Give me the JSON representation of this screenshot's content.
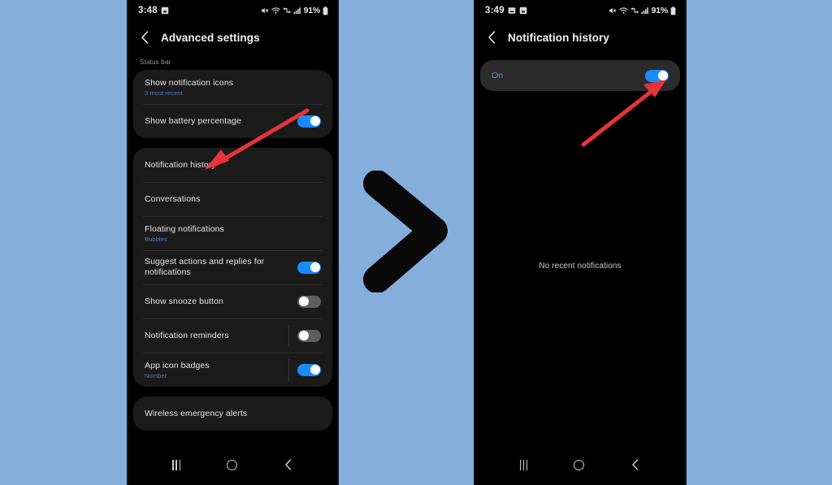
{
  "meta": {
    "background_color": "#86aedc",
    "accent_blue": "#1a8cff",
    "link_blue": "#4e7fd0",
    "arrow_red": "#e8333a",
    "card_color": "#1b1b1b",
    "card_highlight_color": "#2b2b2b"
  },
  "left_phone": {
    "status_bar": {
      "time": "3:48",
      "battery": "91%",
      "icons": [
        "mute-icon",
        "wifi-icon",
        "vpn-icon",
        "signal-icon",
        "battery-icon"
      ]
    },
    "app_bar": {
      "back_icon": "back-chevron-icon",
      "title": "Advanced settings"
    },
    "section_label": "Status bar",
    "cards": [
      {
        "rows": [
          {
            "title": "Show notification icons",
            "subtitle": "3 most recent",
            "toggle": null
          },
          {
            "title": "Show battery percentage",
            "subtitle": "",
            "toggle": "on"
          }
        ]
      },
      {
        "rows": [
          {
            "title": "Notification history",
            "subtitle": "",
            "toggle": null
          },
          {
            "title": "Conversations",
            "subtitle": "",
            "toggle": null
          },
          {
            "title": "Floating notifications",
            "subtitle": "Bubbles",
            "toggle": null
          },
          {
            "title": "Suggest actions and replies for notifications",
            "subtitle": "",
            "toggle": "on"
          },
          {
            "title": "Show snooze button",
            "subtitle": "",
            "toggle": "off"
          },
          {
            "title": "Notification reminders",
            "subtitle": "",
            "toggle": "off"
          },
          {
            "title": "App icon badges",
            "subtitle": "Number",
            "toggle": "on"
          }
        ]
      },
      {
        "rows": [
          {
            "title": "Wireless emergency alerts",
            "subtitle": "",
            "toggle": null
          }
        ]
      }
    ],
    "nav_bar": {
      "recents": "recents-icon",
      "home": "home-icon",
      "back": "back-icon"
    }
  },
  "right_phone": {
    "status_bar": {
      "time": "3:49",
      "battery": "91%",
      "icons": [
        "screenshot-icon",
        "mute-icon",
        "wifi-icon",
        "vpn-icon",
        "signal-icon",
        "battery-icon"
      ]
    },
    "app_bar": {
      "back_icon": "back-chevron-icon",
      "title": "Notification history"
    },
    "master_row": {
      "label": "On",
      "toggle": "on"
    },
    "empty_state": "No recent notifications",
    "nav_bar": {
      "recents": "recents-icon",
      "home": "home-icon",
      "back": "back-icon"
    }
  },
  "annotations": {
    "center_chevron": "chevron-right-icon",
    "left_arrow": "red-arrow-pointing-to-notification-history",
    "right_arrow": "red-arrow-pointing-to-toggle"
  }
}
